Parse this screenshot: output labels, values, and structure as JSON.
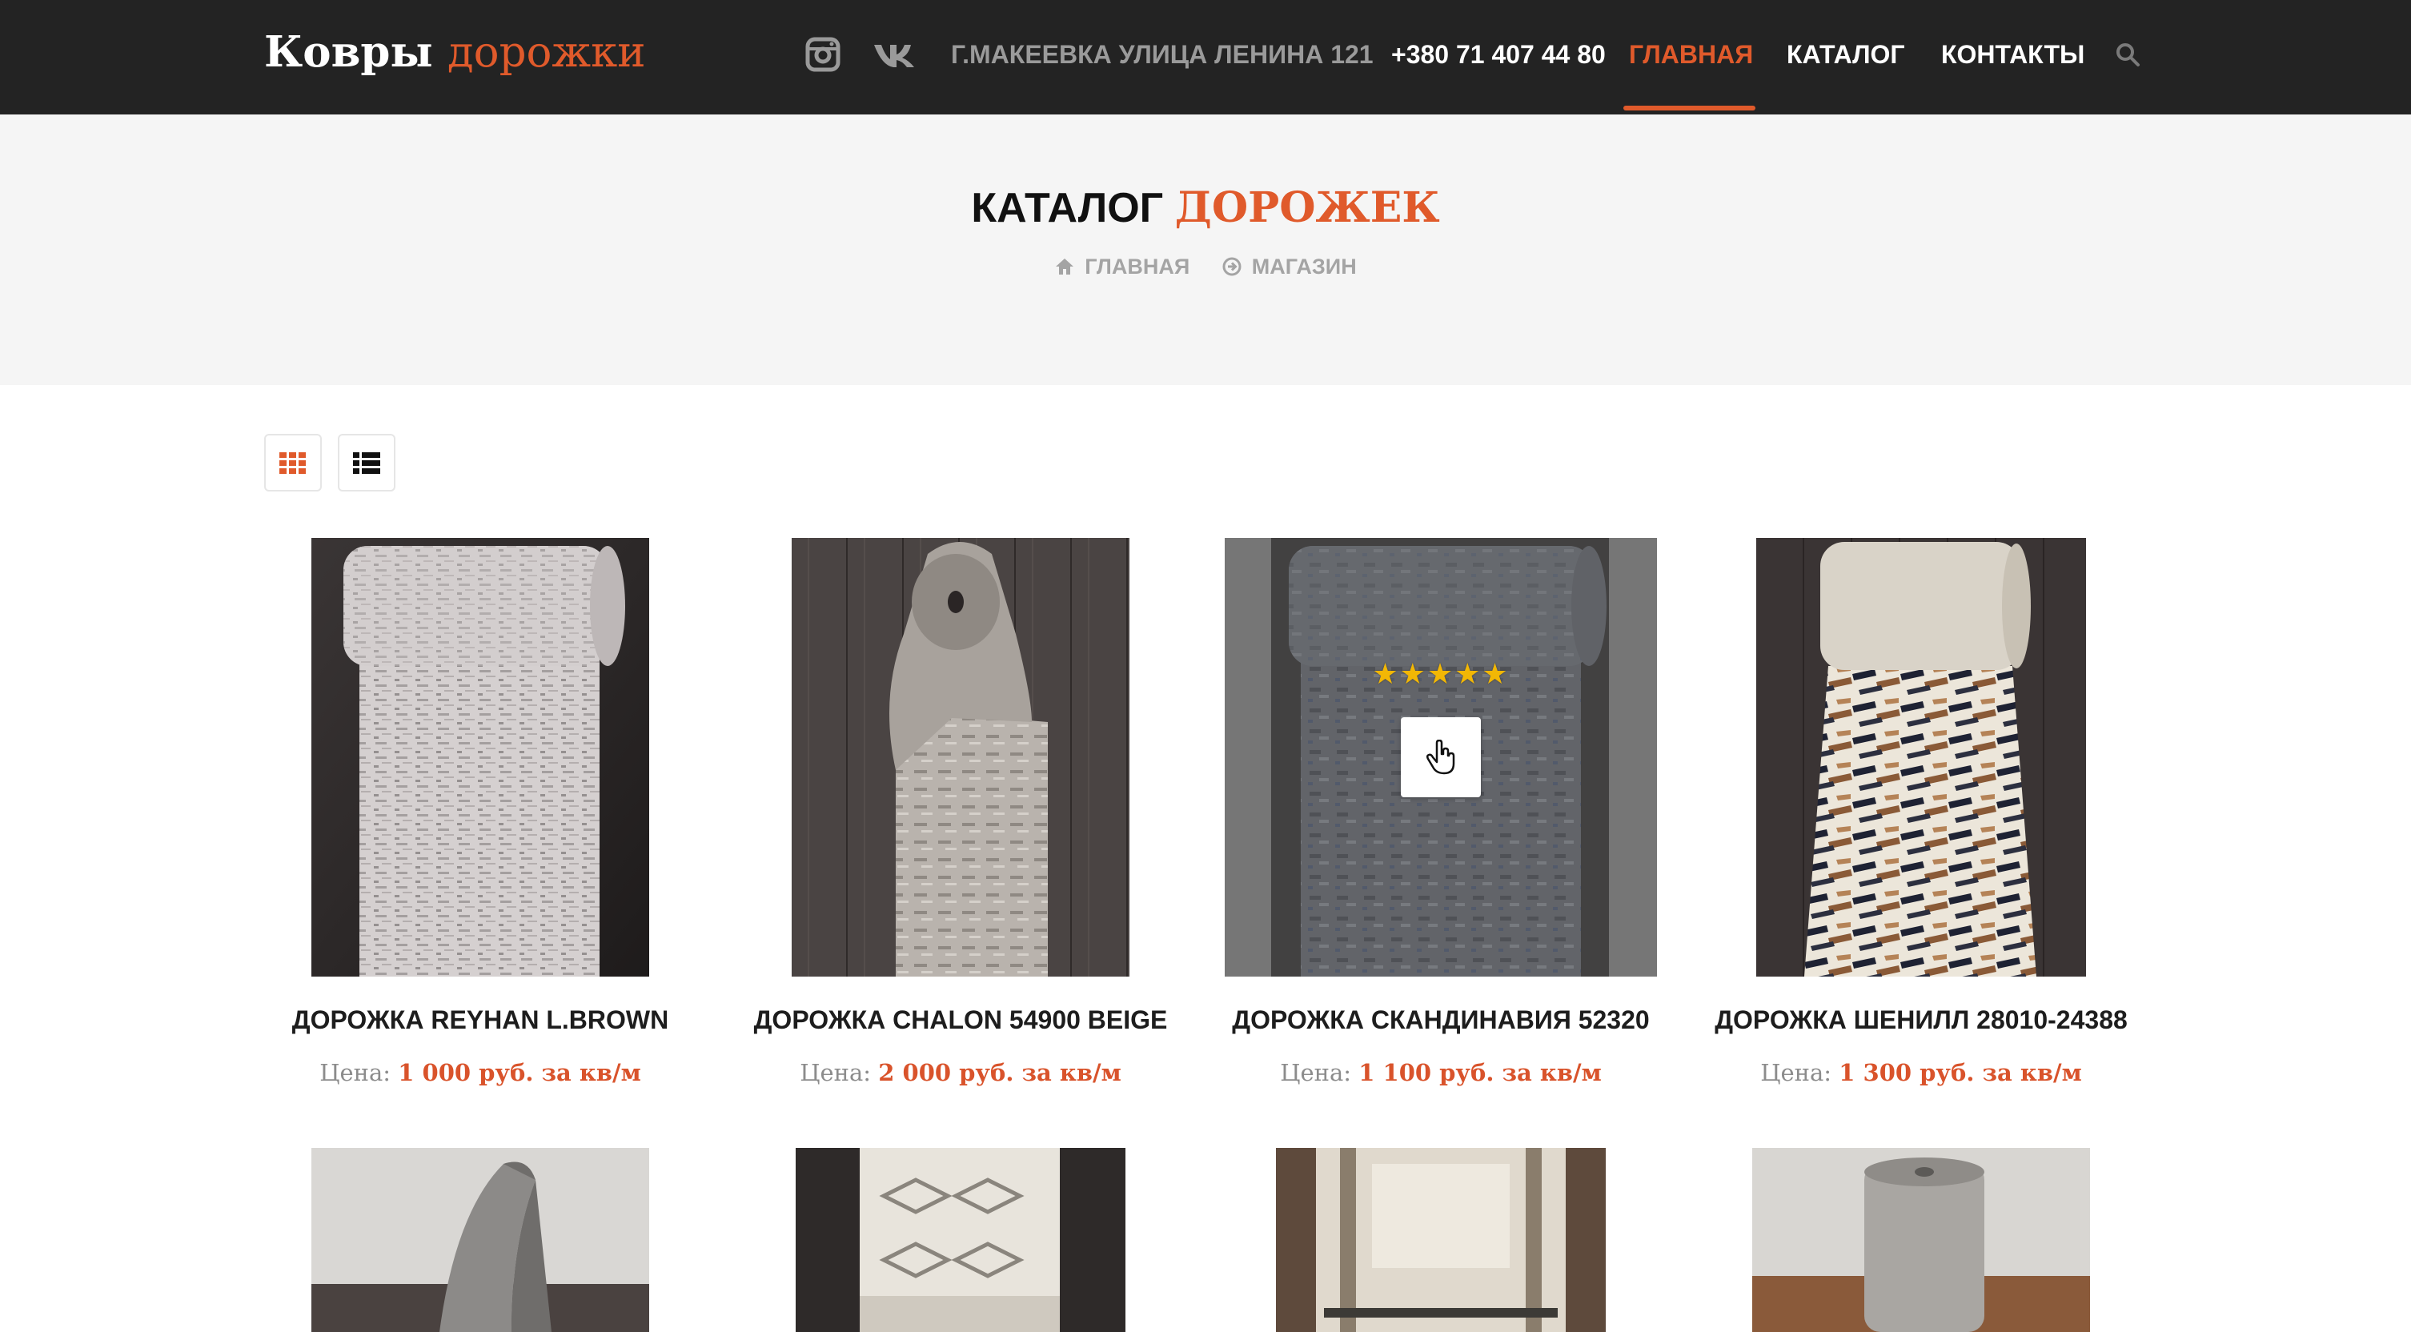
{
  "brand": {
    "name_main": "Ковры",
    "name_accent": "дорожки"
  },
  "nav": {
    "instagram_icon": "instagram-icon",
    "vk_icon": "vk-icon",
    "address": "Г.МАКЕЕВКА УЛИЦА ЛЕНИНА 121",
    "phone": "+380 71 407 44 80",
    "home": "ГЛАВНАЯ",
    "catalog": "КАТАЛОГ",
    "contacts": "КОНТАКТЫ",
    "search_icon": "search-icon",
    "active_item": "ГЛАВНАЯ"
  },
  "page_header": {
    "title_main": "КАТАЛОГ",
    "title_accent": "ДОРОЖЕК",
    "breadcrumb": [
      {
        "icon": "home-icon",
        "label": "ГЛАВНАЯ"
      },
      {
        "icon": "circle-arrow-icon",
        "label": "МАГАЗИН"
      }
    ]
  },
  "view_toggle": {
    "grid_icon": "grid-view-icon",
    "list_icon": "list-view-icon",
    "active": "grid"
  },
  "products": [
    {
      "name": "ДОРОЖКА REYHAN L.BROWN",
      "price_label": "Цена:",
      "price": "1 000 руб. за кв/м"
    },
    {
      "name": "ДОРОЖКА CHALON 54900 BEIGE",
      "price_label": "Цена:",
      "price": "2 000 руб. за кв/м"
    },
    {
      "name": "ДОРОЖКА СКАНДИНАВИЯ 52320",
      "price_label": "Цена:",
      "price": "1 100 руб. за кв/м",
      "rating_stars": 5,
      "hovered": true
    },
    {
      "name": "ДОРОЖКА ШЕНИЛЛ 28010-24388",
      "price_label": "Цена:",
      "price": "1 300 руб. за кв/м"
    }
  ],
  "hover_card": {
    "stars_text": "★★★★★",
    "quick_view_icon": "hand-pointer-icon"
  },
  "colors": {
    "accent": "#e05a2b",
    "navbar_bg": "#232323",
    "header_bg": "#f5f5f5",
    "price": "#d9532b",
    "star": "#f2b705"
  }
}
